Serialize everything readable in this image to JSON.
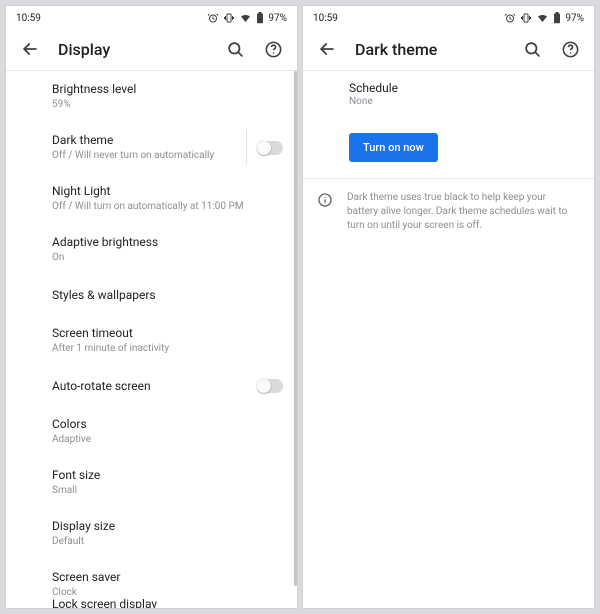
{
  "status": {
    "time": "10:59",
    "battery_pct": "97%"
  },
  "left": {
    "title": "Display",
    "items": [
      {
        "title": "Brightness level",
        "sub": "59%"
      },
      {
        "title": "Dark theme",
        "sub": "Off / Will never turn on automatically",
        "toggle": true,
        "sep": true
      },
      {
        "title": "Night Light",
        "sub": "Off / Will turn on automatically at 11:00 PM"
      },
      {
        "title": "Adaptive brightness",
        "sub": "On"
      },
      {
        "title": "Styles & wallpapers"
      },
      {
        "title": "Screen timeout",
        "sub": "After 1 minute of inactivity"
      },
      {
        "title": "Auto-rotate screen",
        "toggle": true
      },
      {
        "title": "Colors",
        "sub": "Adaptive"
      },
      {
        "title": "Font size",
        "sub": "Small"
      },
      {
        "title": "Display size",
        "sub": "Default"
      },
      {
        "title": "Screen saver",
        "sub": "Clock"
      }
    ],
    "cutoff_title": "Lock screen display"
  },
  "right": {
    "title": "Dark theme",
    "schedule_label": "Schedule",
    "schedule_value": "None",
    "turn_on_label": "Turn on now",
    "info": "Dark theme uses true black to help keep your battery alive longer. Dark theme schedules wait to turn on until your screen is off."
  }
}
